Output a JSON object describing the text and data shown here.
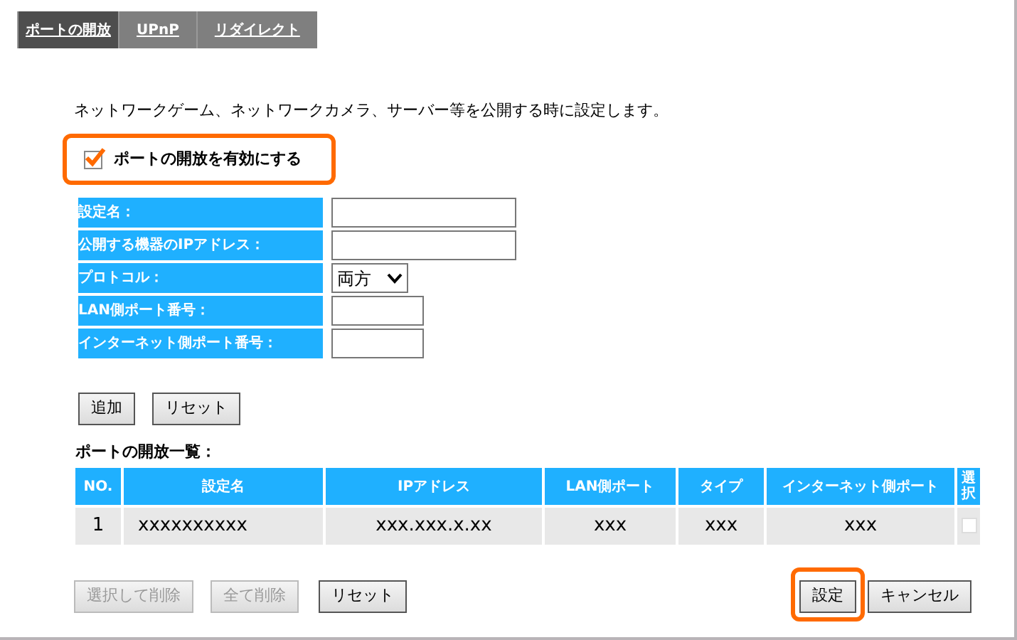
{
  "tabs": [
    {
      "label": "ポートの開放",
      "selected": true
    },
    {
      "label": "UPnP",
      "selected": false
    },
    {
      "label": "リダイレクト",
      "selected": false
    }
  ],
  "description": "ネットワークゲーム、ネットワークカメラ、サーバー等を公開する時に設定します。",
  "enable": {
    "label": "ポートの開放を有効にする",
    "checked": true,
    "highlighted": true
  },
  "form": [
    {
      "label": "設定名：",
      "kind": "wide"
    },
    {
      "label": "公開する機器のIPアドレス：",
      "kind": "wide"
    },
    {
      "label": "プロトコル：",
      "kind": "select",
      "value": "両方"
    },
    {
      "label": "LAN側ポート番号：",
      "kind": "narrow"
    },
    {
      "label": "インターネット側ポート番号：",
      "kind": "narrow"
    }
  ],
  "form_buttons": [
    "追加",
    "リセット"
  ],
  "list_title": "ポートの開放一覧：",
  "table": {
    "columns": [
      "NO.",
      "設定名",
      "IPアドレス",
      "LAN側ポート",
      "タイプ",
      "インターネット側ポート",
      "選択"
    ],
    "rows": [
      {
        "cells": [
          "1",
          "xxxxxxxxxx",
          "xxx.xxx.x.xx",
          "xxx",
          "xxx",
          "xxx"
        ],
        "checked": false
      }
    ]
  },
  "bottom_buttons": [
    {
      "label": "選択して削除",
      "disabled": true,
      "highlighted": false
    },
    {
      "label": "全て削除",
      "disabled": true,
      "highlighted": false
    },
    {
      "label": "リセット",
      "disabled": false,
      "highlighted": false
    }
  ],
  "action_buttons": [
    {
      "label": "設定",
      "highlighted": true
    },
    {
      "label": "キャンセル",
      "highlighted": false
    }
  ]
}
